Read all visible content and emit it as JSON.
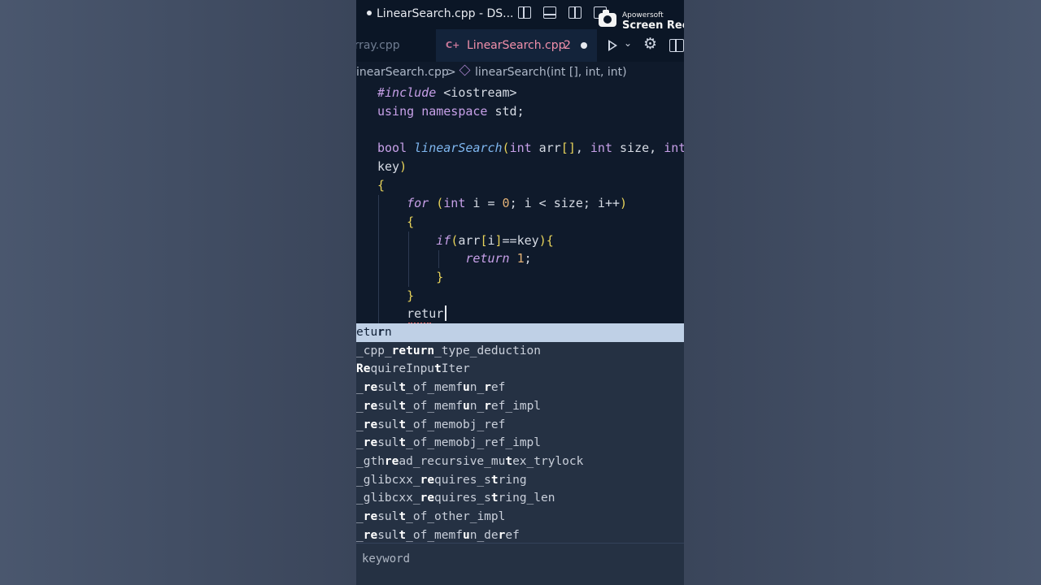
{
  "window": {
    "title": "LinearSearch.cpp - DS...",
    "watermark_brand": "Apowersoft",
    "watermark_text": "Screen Rece"
  },
  "tabs": {
    "prev_label": "Array.cpp",
    "active_label": "LinearSearch.cpp",
    "active_icon": "C+",
    "active_problem_count": "2"
  },
  "breadcrumb": {
    "file": "inearSearch.cpp",
    "separator": ">",
    "symbol": "linearSearch(int [], int, int)"
  },
  "editor": {
    "lines": [
      "#include <iostream>",
      "using namespace std;",
      "",
      "bool linearSearch(int arr[], int size, int",
      "key)",
      "{",
      "    for (int i = 0; i < size; i++)",
      "    {",
      "        if(arr[i]==key){",
      "            return 1;",
      "        }",
      "    }",
      "    retur"
    ]
  },
  "suggestions": {
    "items": [
      "eturn",
      "_cpp_return_type_deduction",
      "RequireInputIter",
      "_result_of_memfun_ref",
      "_result_of_memfun_ref_impl",
      "_result_of_memobj_ref",
      "_result_of_memobj_ref_impl",
      "_gthread_recursive_mutex_trylock",
      "_glibcxx_requires_string",
      "_glibcxx_requires_string_len",
      "_result_of_other_impl",
      "_result_of_memfun_deref"
    ],
    "selected_index": 0,
    "detail": "keyword"
  },
  "colors": {
    "editor_bg": "#0f1a2b",
    "suggest_bg": "#253143",
    "selection": "#bfd0e6",
    "tab_accent": "#f18faa"
  }
}
